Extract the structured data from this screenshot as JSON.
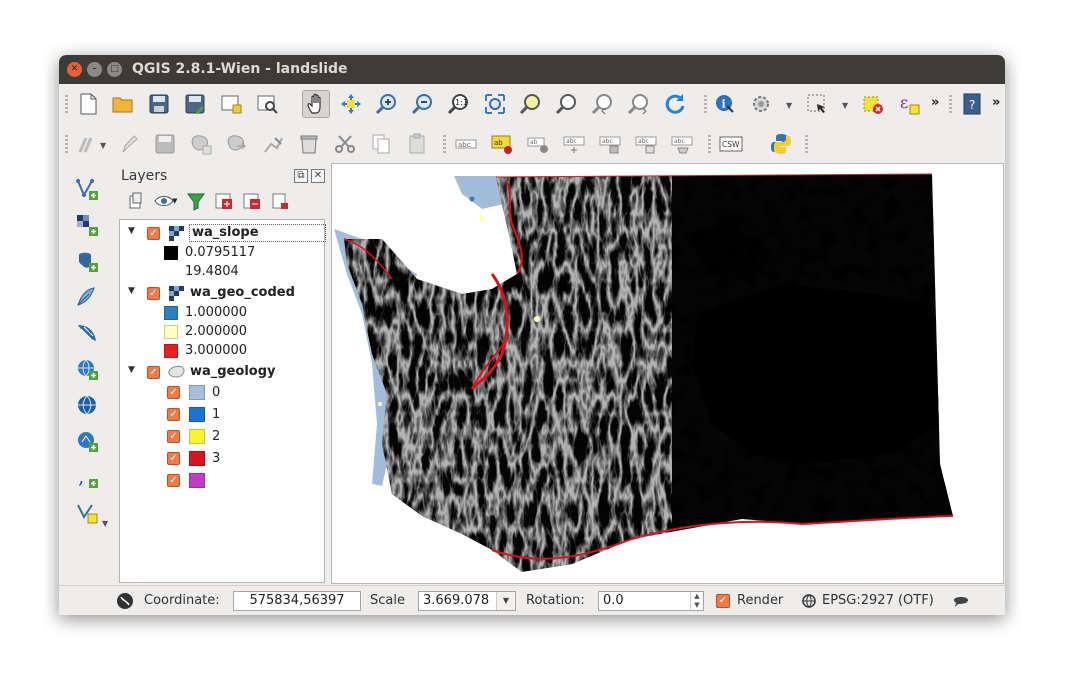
{
  "window": {
    "title": "QGIS 2.8.1-Wien - landslide"
  },
  "toolbar1": {
    "icons": [
      "new-project-icon",
      "open-project-icon",
      "save-project-icon",
      "save-as-icon",
      "new-print-composer-icon",
      "composer-manager-icon",
      "pan-icon",
      "pan-to-selection-icon",
      "zoom-in-icon",
      "zoom-out-icon",
      "zoom-actual-icon",
      "zoom-full-icon",
      "zoom-layer-icon",
      "zoom-selection-icon",
      "zoom-last-icon",
      "zoom-next-icon",
      "refresh-icon",
      "identify-icon",
      "feature-action-icon",
      "select-icon",
      "deselect-icon",
      "expression-icon",
      "help-icon"
    ],
    "more": "»"
  },
  "toolbar2": {
    "icons": [
      "digitize-icon",
      "toggle-edit-icon",
      "save-edits-icon",
      "add-feature-icon",
      "move-feature-icon",
      "node-tool-icon",
      "delete-selected-icon",
      "cut-icon",
      "copy-icon",
      "paste-icon",
      "label-icon",
      "pin-label-icon",
      "show-hide-label-icon",
      "move-label-icon",
      "rotate-label-icon",
      "change-label-icon",
      "label-tool-icon",
      "csw-icon",
      "python-icon"
    ],
    "csw_label": "CSW"
  },
  "layers_panel": {
    "title": "Layers",
    "layers": [
      {
        "name": "wa_slope",
        "type": "raster",
        "legend": [
          {
            "color": "#000000",
            "label": "0.0795117"
          },
          {
            "color": "#ffffff",
            "label": "19.4804"
          }
        ]
      },
      {
        "name": "wa_geo_coded",
        "type": "raster",
        "legend": [
          {
            "color": "#2f7ec0",
            "label": "1.000000"
          },
          {
            "color": "#ffffc0",
            "label": "2.000000"
          },
          {
            "color": "#e52222",
            "label": "3.000000"
          }
        ]
      },
      {
        "name": "wa_geology",
        "type": "vector",
        "legend": [
          {
            "color": "#a7bfde",
            "label": "0"
          },
          {
            "color": "#1e73d2",
            "label": "1"
          },
          {
            "color": "#f5f532",
            "label": "2"
          },
          {
            "color": "#d8141e",
            "label": "3"
          },
          {
            "color": "#c13cc4",
            "label": ""
          }
        ]
      }
    ]
  },
  "statusbar": {
    "coordinate_label": "Coordinate:",
    "coordinate_value": "575834,56397",
    "scale_label": "Scale",
    "scale_value": "3.669.078",
    "rotation_label": "Rotation:",
    "rotation_value": "0.0",
    "render_label": "Render",
    "crs_label": "EPSG:2927 (OTF)"
  }
}
